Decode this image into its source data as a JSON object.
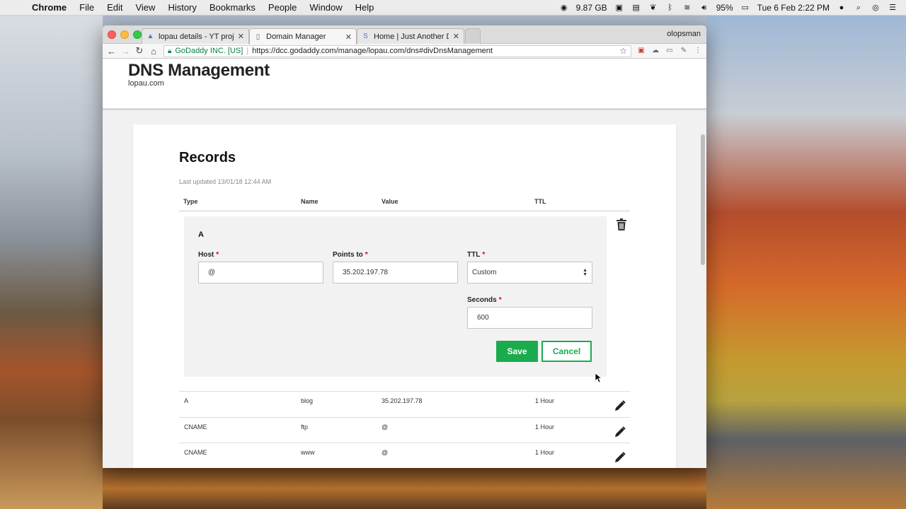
{
  "menubar": {
    "apple_icon": "apple-icon",
    "items": [
      "Chrome",
      "File",
      "Edit",
      "View",
      "History",
      "Bookmarks",
      "People",
      "Window",
      "Help"
    ],
    "memory": "9.87 GB",
    "battery": "95%",
    "datetime": "Tue 6 Feb  2:22 PM"
  },
  "browser": {
    "tabs": [
      {
        "title": "lopau details - YT project",
        "icon": "drive-icon"
      },
      {
        "title": "Domain Manager",
        "icon": "page-icon"
      },
      {
        "title": "Home | Just Another Dang Blo",
        "icon": "s-icon"
      }
    ],
    "profile": "olopsman",
    "ev_label": "GoDaddy INC. [US]",
    "url": "https://dcc.godaddy.com/manage/lopau.com/dns#divDnsManagement"
  },
  "page": {
    "title": "DNS Management",
    "domain": "lopau.com"
  },
  "records": {
    "title": "Records",
    "last_updated": "Last updated 13/01/18 12:44 AM",
    "columns": {
      "type": "Type",
      "name": "Name",
      "value": "Value",
      "ttl": "TTL"
    },
    "editor": {
      "type": "A",
      "host_label": "Host",
      "host_value": "@",
      "points_to_label": "Points to",
      "points_to_value": "35.202.197.78",
      "ttl_label": "TTL",
      "ttl_value": "Custom",
      "seconds_label": "Seconds",
      "seconds_value": "600",
      "required_mark": "*",
      "save_label": "Save",
      "cancel_label": "Cancel"
    },
    "rows": [
      {
        "type": "A",
        "name": "blog",
        "value": "35.202.197.78",
        "ttl": "1 Hour"
      },
      {
        "type": "CNAME",
        "name": "ftp",
        "value": "@",
        "ttl": "1 Hour"
      },
      {
        "type": "CNAME",
        "name": "www",
        "value": "@",
        "ttl": "1 Hour"
      }
    ]
  },
  "colors": {
    "accent_green": "#1bab4f",
    "required_red": "#d0021b"
  }
}
